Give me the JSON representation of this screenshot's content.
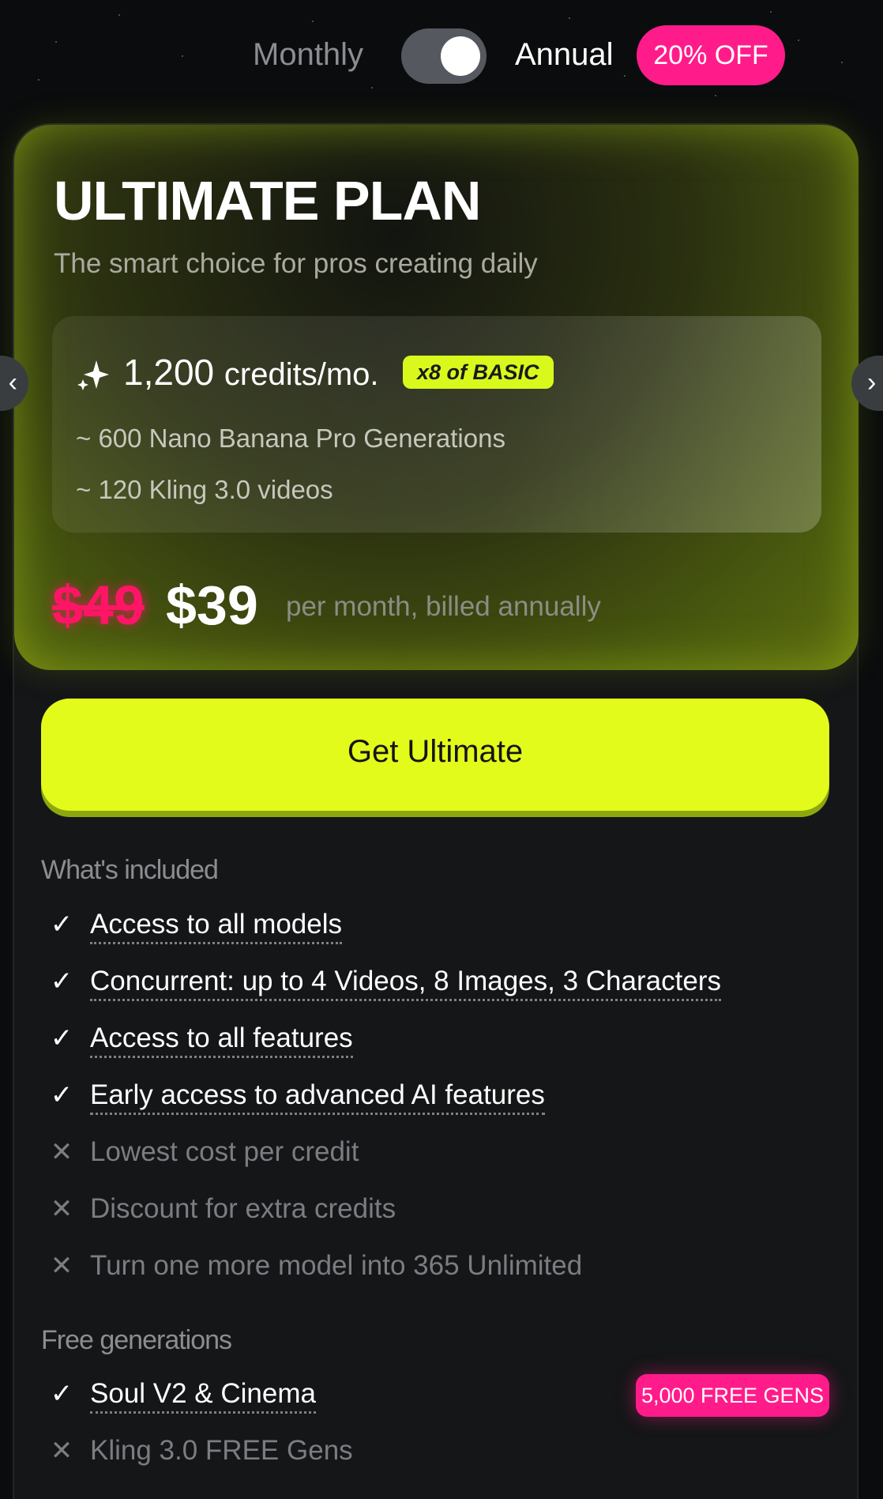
{
  "billing": {
    "monthly_label": "Monthly",
    "annual_label": "Annual",
    "annual_selected": true,
    "discount_badge": "20% OFF"
  },
  "nav": {
    "prev_glyph": "‹",
    "next_glyph": "›"
  },
  "plan": {
    "title": "ULTIMATE PLAN",
    "subtitle": "The smart choice for pros creating daily",
    "credits": {
      "amount": "1,200",
      "unit": "credits/mo.",
      "multiplier_badge": "x8 of BASIC",
      "line_1": "~ 600 Nano Banana Pro Generations",
      "line_2": "~ 120 Kling 3.0 videos"
    },
    "price": {
      "old": "$49",
      "new": "$39",
      "note": "per month, billed annually"
    },
    "cta_label": "Get Ultimate"
  },
  "included": {
    "title": "What's included",
    "check_glyph": "✓",
    "cross_glyph": "✕",
    "items": [
      {
        "label": "Access to all models",
        "included": true
      },
      {
        "label": "Concurrent: up to 4 Videos, 8 Images, 3 Characters",
        "included": true
      },
      {
        "label": "Access to all features",
        "included": true
      },
      {
        "label": "Early access to advanced AI features",
        "included": true
      },
      {
        "label": "Lowest cost per credit",
        "included": false
      },
      {
        "label": "Discount for extra credits",
        "included": false
      },
      {
        "label": "Turn one more model into 365 Unlimited",
        "included": false
      }
    ]
  },
  "free_generations": {
    "title": "Free generations",
    "items": [
      {
        "label": "Soul V2 & Cinema",
        "included": true,
        "badge": "5,000 FREE GENS"
      },
      {
        "label": "Kling 3.0 FREE Gens",
        "included": false
      }
    ]
  },
  "colors": {
    "accent_lime": "#e3fb1b",
    "accent_pink": "#ff1c8a",
    "old_price_red": "#ff1566",
    "background": "#0b0c0d"
  }
}
